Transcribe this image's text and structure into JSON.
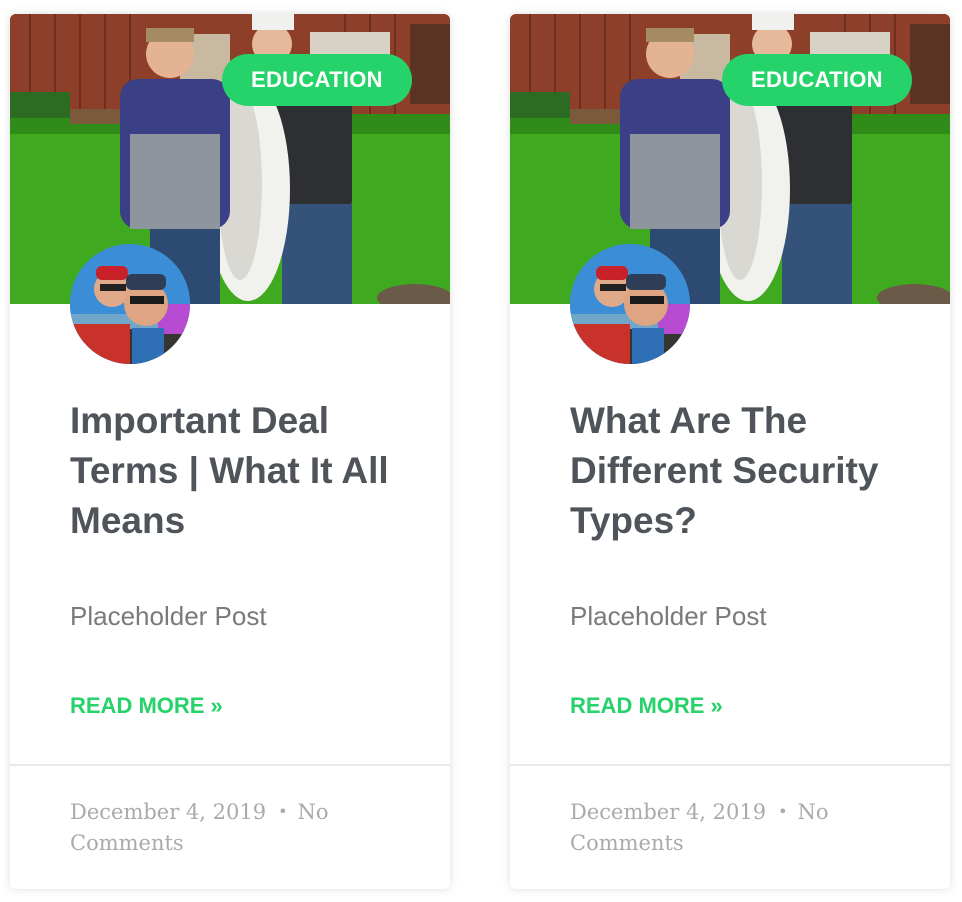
{
  "posts": [
    {
      "category": "EDUCATION",
      "title": "Important Deal Terms | What It All Means",
      "excerpt": "Placeholder Post",
      "read_more": "READ MORE »",
      "date": "December 4, 2019",
      "separator": "•",
      "comments": "No Comments"
    },
    {
      "category": "EDUCATION",
      "title": "What Are The Different Security Types?",
      "excerpt": "Placeholder Post",
      "read_more": "READ MORE »",
      "date": "December 4, 2019",
      "separator": "•",
      "comments": "No Comments"
    }
  ],
  "colors": {
    "accent": "#26d26a",
    "title": "#4f535a",
    "excerpt": "#7a7a7a",
    "meta": "#aaaaaa"
  },
  "icons": {
    "thumbnail": "photo-of-two-men-holding-a-halibut",
    "avatar": "photo-of-two-men-on-a-boat"
  }
}
